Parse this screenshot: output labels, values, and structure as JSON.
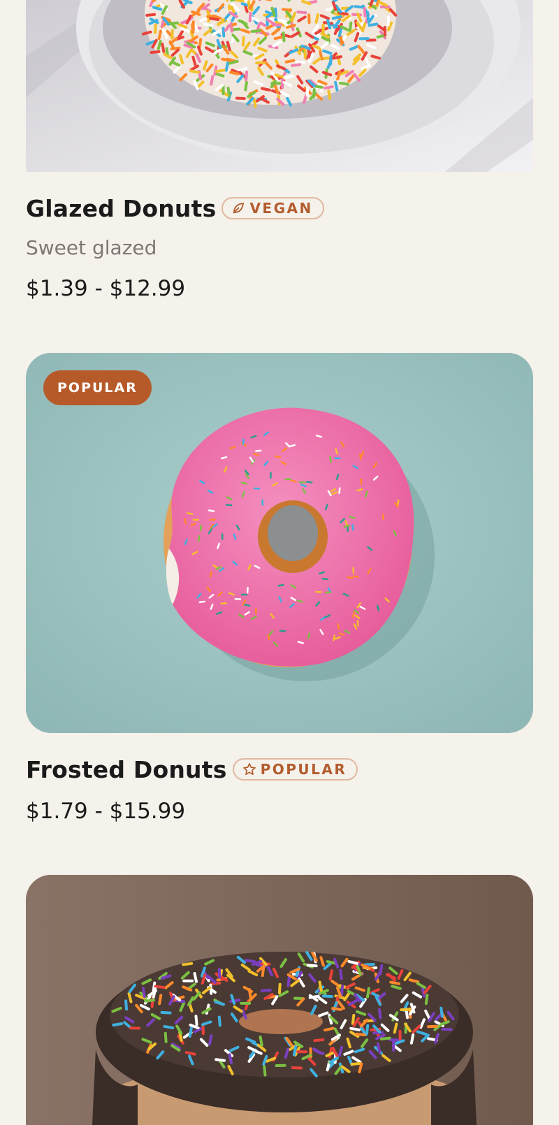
{
  "products": [
    {
      "name": "Glazed Donuts",
      "tag": {
        "label": "VEGAN",
        "icon": "leaf-icon"
      },
      "description": "Sweet glazed",
      "price": "$1.39 - $12.99",
      "image_subject": "sprinkle-donut-on-plate"
    },
    {
      "name": "Frosted Donuts",
      "image_badge": "POPULAR",
      "tag": {
        "label": "POPULAR",
        "icon": "star-icon"
      },
      "price": "$1.79 - $15.99",
      "image_subject": "pink-frosted-donut"
    },
    {
      "image_subject": "chocolate-sprinkle-donut"
    }
  ],
  "colors": {
    "background": "#f5f1eb",
    "accent": "#b75a2a",
    "tag_border": "#e2b89f",
    "text_primary": "#1b1b1b",
    "text_secondary": "#7d7874"
  }
}
